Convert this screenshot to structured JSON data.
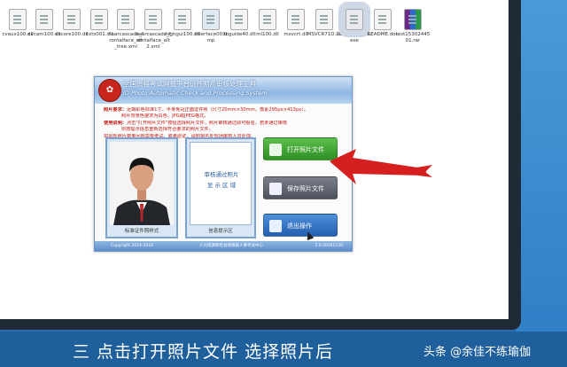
{
  "desktop_icons": [
    {
      "label": "cvaux100.dll",
      "type": "file"
    },
    {
      "label": "cvcam100.dll",
      "type": "file"
    },
    {
      "label": "cxcore100.dll",
      "type": "file"
    },
    {
      "label": "cxts001.dll",
      "type": "file"
    },
    {
      "label": "haarcascade_frontalface_alt_tree.xml",
      "type": "file"
    },
    {
      "label": "haarcascade_frontalface_alt2.xml",
      "type": "file"
    },
    {
      "label": "highgui100.dll",
      "type": "file"
    },
    {
      "label": "interface00.bmp",
      "type": "img"
    },
    {
      "label": "libguide40.dll",
      "type": "file"
    },
    {
      "label": "ml100.dll",
      "type": "file"
    },
    {
      "label": "msvcrt.dll",
      "type": "file"
    },
    {
      "label": "MSVCR71D.LL",
      "type": "file"
    },
    {
      "label": "PhotoProcess.exe",
      "type": "exe_selected"
    },
    {
      "label": "README.doc",
      "type": "file"
    },
    {
      "label": "test1530244501.rar",
      "type": "rar"
    }
  ],
  "app": {
    "title": "全国资格考试网报平台证件照片审核处理工具",
    "subtitle": "ID Photo Automatic Check and Processing System",
    "notice": [
      {
        "key": "照片要求：",
        "text": "近期彩色标准1寸，半身免冠正面证件照（尺寸20mm×30mm，像素295px×413px）。"
      },
      {
        "key": "",
        "text": "照片背景色要求为白色，JPG或JPEG格式。"
      },
      {
        "key": "使用说明：",
        "text": "点击\"打开照片文件\"按钮选择照片文件，照片审核通过即可报名，若未通过审核"
      },
      {
        "key": "",
        "text": "则按提示信息重新选择符合要求的照片文件。"
      },
      {
        "key": "",
        "text": "如出现照片数量问题需要考试、或者验证，请到报名处现场审核人员处理。"
      }
    ],
    "photo_caption": "标准证件照样式",
    "review_text_1": "审核通过照片",
    "review_text_2": "显 示 区 域",
    "review_caption": "信息提示区",
    "buttons": {
      "open": "打开照片文件",
      "save": "保存照片文件",
      "exit": "退出操作"
    },
    "footer": {
      "left": "Copyright 2014-2016",
      "middle": "人力资源和社会保障部人事考试中心",
      "right": "2.0 20161130"
    }
  },
  "caption": "三 点击打开照片文件 选择照片后",
  "watermark": "头条 @余佳不练瑜伽",
  "colors": {
    "arrow": "#d61f1f",
    "open_button": "#3ea832",
    "save_button": "#5f636d",
    "exit_button": "#2f6fc0"
  }
}
